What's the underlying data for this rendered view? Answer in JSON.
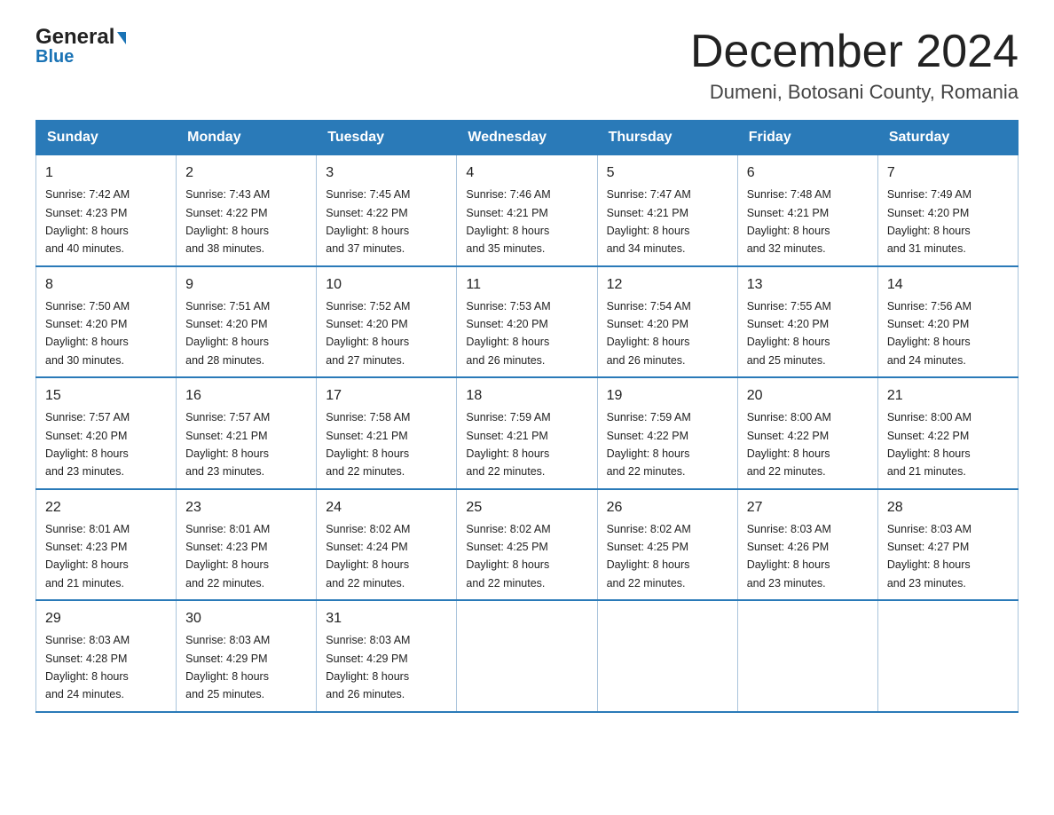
{
  "logo": {
    "general": "General",
    "blue": "Blue",
    "arrow": "▶"
  },
  "header": {
    "month_year": "December 2024",
    "location": "Dumeni, Botosani County, Romania"
  },
  "columns": [
    "Sunday",
    "Monday",
    "Tuesday",
    "Wednesday",
    "Thursday",
    "Friday",
    "Saturday"
  ],
  "weeks": [
    [
      {
        "day": "1",
        "sunrise": "7:42 AM",
        "sunset": "4:23 PM",
        "daylight": "8 hours and 40 minutes."
      },
      {
        "day": "2",
        "sunrise": "7:43 AM",
        "sunset": "4:22 PM",
        "daylight": "8 hours and 38 minutes."
      },
      {
        "day": "3",
        "sunrise": "7:45 AM",
        "sunset": "4:22 PM",
        "daylight": "8 hours and 37 minutes."
      },
      {
        "day": "4",
        "sunrise": "7:46 AM",
        "sunset": "4:21 PM",
        "daylight": "8 hours and 35 minutes."
      },
      {
        "day": "5",
        "sunrise": "7:47 AM",
        "sunset": "4:21 PM",
        "daylight": "8 hours and 34 minutes."
      },
      {
        "day": "6",
        "sunrise": "7:48 AM",
        "sunset": "4:21 PM",
        "daylight": "8 hours and 32 minutes."
      },
      {
        "day": "7",
        "sunrise": "7:49 AM",
        "sunset": "4:20 PM",
        "daylight": "8 hours and 31 minutes."
      }
    ],
    [
      {
        "day": "8",
        "sunrise": "7:50 AM",
        "sunset": "4:20 PM",
        "daylight": "8 hours and 30 minutes."
      },
      {
        "day": "9",
        "sunrise": "7:51 AM",
        "sunset": "4:20 PM",
        "daylight": "8 hours and 28 minutes."
      },
      {
        "day": "10",
        "sunrise": "7:52 AM",
        "sunset": "4:20 PM",
        "daylight": "8 hours and 27 minutes."
      },
      {
        "day": "11",
        "sunrise": "7:53 AM",
        "sunset": "4:20 PM",
        "daylight": "8 hours and 26 minutes."
      },
      {
        "day": "12",
        "sunrise": "7:54 AM",
        "sunset": "4:20 PM",
        "daylight": "8 hours and 26 minutes."
      },
      {
        "day": "13",
        "sunrise": "7:55 AM",
        "sunset": "4:20 PM",
        "daylight": "8 hours and 25 minutes."
      },
      {
        "day": "14",
        "sunrise": "7:56 AM",
        "sunset": "4:20 PM",
        "daylight": "8 hours and 24 minutes."
      }
    ],
    [
      {
        "day": "15",
        "sunrise": "7:57 AM",
        "sunset": "4:20 PM",
        "daylight": "8 hours and 23 minutes."
      },
      {
        "day": "16",
        "sunrise": "7:57 AM",
        "sunset": "4:21 PM",
        "daylight": "8 hours and 23 minutes."
      },
      {
        "day": "17",
        "sunrise": "7:58 AM",
        "sunset": "4:21 PM",
        "daylight": "8 hours and 22 minutes."
      },
      {
        "day": "18",
        "sunrise": "7:59 AM",
        "sunset": "4:21 PM",
        "daylight": "8 hours and 22 minutes."
      },
      {
        "day": "19",
        "sunrise": "7:59 AM",
        "sunset": "4:22 PM",
        "daylight": "8 hours and 22 minutes."
      },
      {
        "day": "20",
        "sunrise": "8:00 AM",
        "sunset": "4:22 PM",
        "daylight": "8 hours and 22 minutes."
      },
      {
        "day": "21",
        "sunrise": "8:00 AM",
        "sunset": "4:22 PM",
        "daylight": "8 hours and 21 minutes."
      }
    ],
    [
      {
        "day": "22",
        "sunrise": "8:01 AM",
        "sunset": "4:23 PM",
        "daylight": "8 hours and 21 minutes."
      },
      {
        "day": "23",
        "sunrise": "8:01 AM",
        "sunset": "4:23 PM",
        "daylight": "8 hours and 22 minutes."
      },
      {
        "day": "24",
        "sunrise": "8:02 AM",
        "sunset": "4:24 PM",
        "daylight": "8 hours and 22 minutes."
      },
      {
        "day": "25",
        "sunrise": "8:02 AM",
        "sunset": "4:25 PM",
        "daylight": "8 hours and 22 minutes."
      },
      {
        "day": "26",
        "sunrise": "8:02 AM",
        "sunset": "4:25 PM",
        "daylight": "8 hours and 22 minutes."
      },
      {
        "day": "27",
        "sunrise": "8:03 AM",
        "sunset": "4:26 PM",
        "daylight": "8 hours and 23 minutes."
      },
      {
        "day": "28",
        "sunrise": "8:03 AM",
        "sunset": "4:27 PM",
        "daylight": "8 hours and 23 minutes."
      }
    ],
    [
      {
        "day": "29",
        "sunrise": "8:03 AM",
        "sunset": "4:28 PM",
        "daylight": "8 hours and 24 minutes."
      },
      {
        "day": "30",
        "sunrise": "8:03 AM",
        "sunset": "4:29 PM",
        "daylight": "8 hours and 25 minutes."
      },
      {
        "day": "31",
        "sunrise": "8:03 AM",
        "sunset": "4:29 PM",
        "daylight": "8 hours and 26 minutes."
      },
      null,
      null,
      null,
      null
    ]
  ],
  "day_labels": {
    "sunrise": "Sunrise:",
    "sunset": "Sunset:",
    "daylight": "Daylight:"
  }
}
